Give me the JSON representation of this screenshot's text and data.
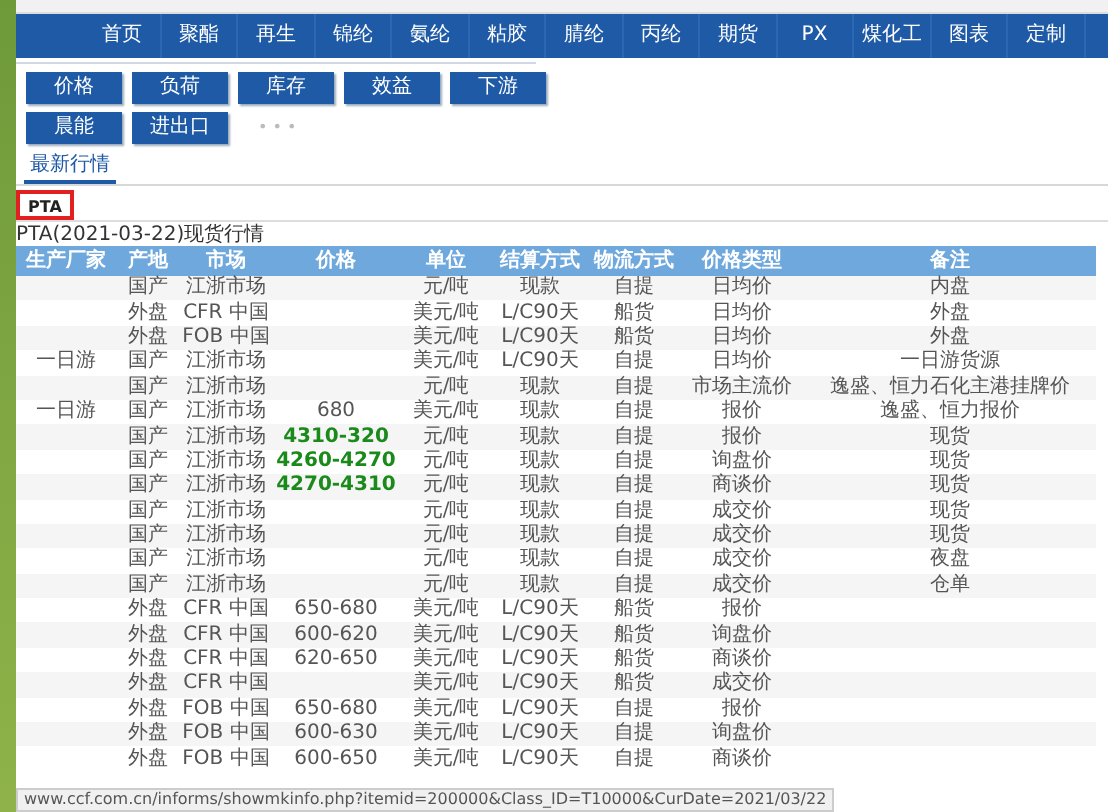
{
  "nav": {
    "items": [
      "首页",
      "聚酯",
      "再生",
      "锦纶",
      "氨纶",
      "粘胶",
      "腈纶",
      "丙纶",
      "期货",
      "PX",
      "煤化工",
      "图表",
      "定制"
    ]
  },
  "category_buttons": [
    [
      "价格",
      "负荷",
      "库存",
      "效益",
      "下游"
    ],
    [
      "晨能",
      "进出口"
    ]
  ],
  "more_indicator": "• • •",
  "tabs": [
    {
      "label": "最新行情",
      "selected": true
    }
  ],
  "product_tabs": [
    {
      "label": "PTA",
      "selected": true
    }
  ],
  "caption": "PTA(2021-03-22)现货行情",
  "table": {
    "columns": [
      "生产厂家",
      "产地",
      "市场",
      "价格",
      "单位",
      "结算方式",
      "物流方式",
      "价格类型",
      "备注"
    ],
    "rows": [
      {
        "origin": "国产",
        "market": "江浙市场",
        "unit": "元/吨",
        "settlement": "现款",
        "logistics": "自提",
        "price_type": "日均价",
        "note": "内盘"
      },
      {
        "origin": "外盘",
        "market": "CFR 中国",
        "unit": "美元/吨",
        "settlement": "L/C90天",
        "logistics": "船货",
        "price_type": "日均价",
        "note": "外盘"
      },
      {
        "origin": "外盘",
        "market": "FOB 中国",
        "unit": "美元/吨",
        "settlement": "L/C90天",
        "logistics": "船货",
        "price_type": "日均价",
        "note": "外盘"
      },
      {
        "maker": "一日游",
        "origin": "国产",
        "market": "江浙市场",
        "unit": "美元/吨",
        "settlement": "L/C90天",
        "logistics": "自提",
        "price_type": "日均价",
        "note": "一日游货源"
      },
      {
        "origin": "国产",
        "market": "江浙市场",
        "unit": "元/吨",
        "settlement": "现款",
        "logistics": "自提",
        "price_type": "市场主流价",
        "note": "逸盛、恒力石化主港挂牌价"
      },
      {
        "maker": "一日游",
        "origin": "国产",
        "market": "江浙市场",
        "price": "680",
        "unit": "美元/吨",
        "settlement": "现款",
        "logistics": "自提",
        "price_type": "报价",
        "note": "逸盛、恒力报价",
        "price_emphasis": false
      },
      {
        "origin": "国产",
        "market": "江浙市场",
        "price": "4310-320",
        "unit": "元/吨",
        "settlement": "现款",
        "logistics": "自提",
        "price_type": "报价",
        "note": "现货",
        "price_emphasis": true
      },
      {
        "origin": "国产",
        "market": "江浙市场",
        "price": "4260-4270",
        "unit": "元/吨",
        "settlement": "现款",
        "logistics": "自提",
        "price_type": "询盘价",
        "note": "现货",
        "price_emphasis": true
      },
      {
        "origin": "国产",
        "market": "江浙市场",
        "price": "4270-4310",
        "unit": "元/吨",
        "settlement": "现款",
        "logistics": "自提",
        "price_type": "商谈价",
        "note": "现货",
        "price_emphasis": true
      },
      {
        "origin": "国产",
        "market": "江浙市场",
        "unit": "元/吨",
        "settlement": "现款",
        "logistics": "自提",
        "price_type": "成交价",
        "note": "现货"
      },
      {
        "origin": "国产",
        "market": "江浙市场",
        "unit": "元/吨",
        "settlement": "现款",
        "logistics": "自提",
        "price_type": "成交价",
        "note": "现货"
      },
      {
        "origin": "国产",
        "market": "江浙市场",
        "unit": "元/吨",
        "settlement": "现款",
        "logistics": "自提",
        "price_type": "成交价",
        "note": "夜盘"
      },
      {
        "origin": "国产",
        "market": "江浙市场",
        "unit": "元/吨",
        "settlement": "现款",
        "logistics": "自提",
        "price_type": "成交价",
        "note": "仓单"
      },
      {
        "origin": "外盘",
        "market": "CFR 中国",
        "price": "650-680",
        "unit": "美元/吨",
        "settlement": "L/C90天",
        "logistics": "船货",
        "price_type": "报价",
        "price_emphasis": false
      },
      {
        "origin": "外盘",
        "market": "CFR 中国",
        "price": "600-620",
        "unit": "美元/吨",
        "settlement": "L/C90天",
        "logistics": "船货",
        "price_type": "询盘价",
        "price_emphasis": false
      },
      {
        "origin": "外盘",
        "market": "CFR 中国",
        "price": "620-650",
        "unit": "美元/吨",
        "settlement": "L/C90天",
        "logistics": "船货",
        "price_type": "商谈价",
        "price_emphasis": false
      },
      {
        "origin": "外盘",
        "market": "CFR 中国",
        "unit": "美元/吨",
        "settlement": "L/C90天",
        "logistics": "船货",
        "price_type": "成交价"
      },
      {
        "origin": "外盘",
        "market": "FOB 中国",
        "price": "650-680",
        "unit": "美元/吨",
        "settlement": "L/C90天",
        "logistics": "自提",
        "price_type": "报价",
        "price_emphasis": false
      },
      {
        "origin": "外盘",
        "market": "FOB 中国",
        "price": "600-630",
        "unit": "美元/吨",
        "settlement": "L/C90天",
        "logistics": "自提",
        "price_type": "询盘价",
        "price_emphasis": false
      },
      {
        "origin": "外盘",
        "market": "FOB 中国",
        "price": "600-650",
        "unit": "美元/吨",
        "settlement": "L/C90天",
        "logistics": "自提",
        "price_type": "商谈价",
        "price_emphasis": false
      }
    ]
  },
  "status_bar": {
    "url": "www.ccf.com.cn/informs/showmkinfo.php?itemid=200000&Class_ID=T10000&CurDate=2021/03/22"
  }
}
